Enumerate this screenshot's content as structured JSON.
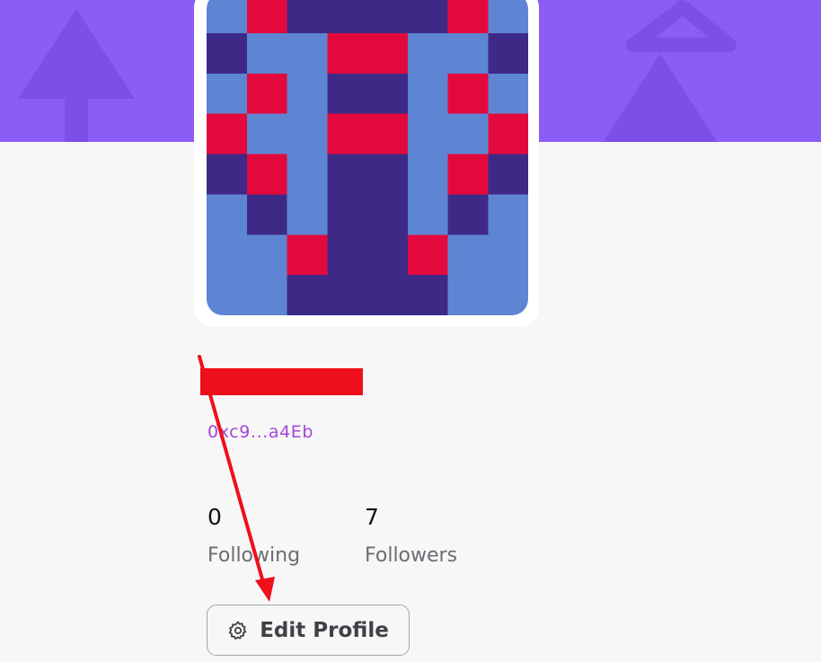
{
  "profile": {
    "address_short": "0xc9...a4Eb",
    "following_count": "0",
    "following_label": "Following",
    "followers_count": "7",
    "followers_label": "Followers",
    "edit_button_label": "Edit Profile"
  },
  "icons": {
    "edit_button_icon": "gear-icon"
  },
  "colors": {
    "banner": "#8b5cf6",
    "avatar_red": "#e4093d",
    "avatar_light_blue": "#5e85d4",
    "avatar_dark_purple": "#3e2a86",
    "address_text": "#a646d9",
    "annotation_red": "#ef0f1a"
  }
}
